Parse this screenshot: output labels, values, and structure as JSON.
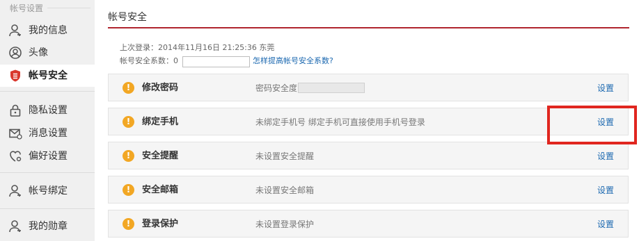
{
  "sidebar": {
    "title": "帐号设置",
    "items": [
      {
        "label": "我的信息",
        "icon": "user-icon"
      },
      {
        "label": "头像",
        "icon": "avatar-icon"
      },
      {
        "label": "帐号安全",
        "icon": "shield-icon",
        "active": true
      },
      {
        "label": "隐私设置",
        "icon": "lock-icon"
      },
      {
        "label": "消息设置",
        "icon": "mail-icon"
      },
      {
        "label": "偏好设置",
        "icon": "heart-gear-icon"
      },
      {
        "label": "帐号绑定",
        "icon": "user-bind-icon"
      },
      {
        "label": "我的勋章",
        "icon": "medal-user-icon"
      }
    ]
  },
  "main": {
    "title": "帐号安全",
    "last_login_label": "上次登录：",
    "last_login_value": "2014年11月16日  21:25:36  东莞",
    "score_label": "帐号安全系数：",
    "score_value": "0",
    "improve_link": "怎样提高帐号安全系数?",
    "rows": [
      {
        "name": "修改密码",
        "desc": "密码安全度",
        "action": "设置",
        "status_icon": "warning-icon"
      },
      {
        "name": "绑定手机",
        "desc": "未绑定手机号 绑定手机可直接使用手机号登录",
        "action": "设置",
        "status_icon": "warning-icon"
      },
      {
        "name": "安全提醒",
        "desc": "未设置安全提醒",
        "action": "设置",
        "status_icon": "warning-icon"
      },
      {
        "name": "安全邮箱",
        "desc": "未设置安全邮箱",
        "action": "设置",
        "status_icon": "warning-icon"
      },
      {
        "name": "登录保护",
        "desc": "未设置登录保护",
        "action": "设置",
        "status_icon": "warning-icon"
      }
    ],
    "warning_glyph": "!"
  },
  "colors": {
    "accent_red": "#b0242e",
    "link_blue": "#1b68b0",
    "warning_orange": "#f2a724",
    "highlight_red": "#e0261f"
  }
}
